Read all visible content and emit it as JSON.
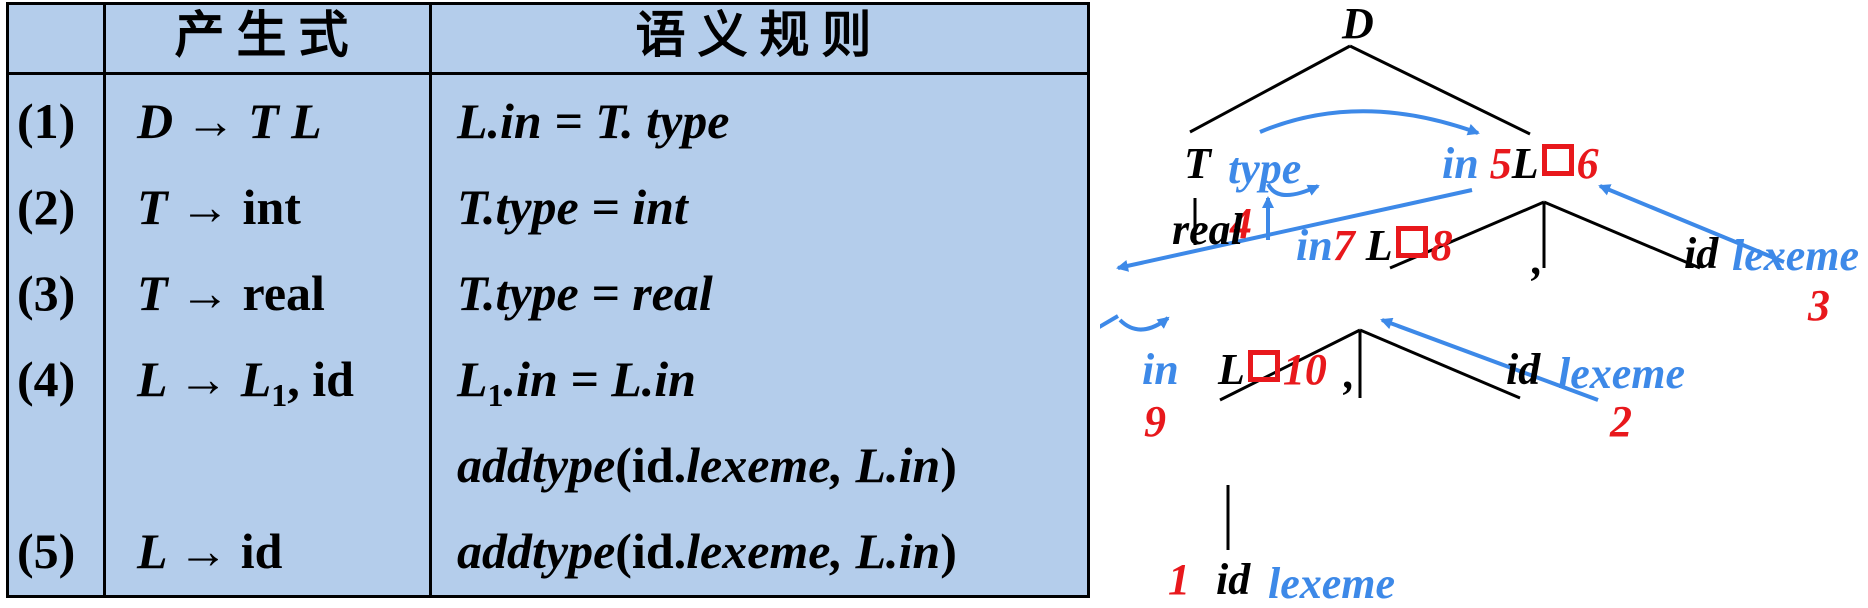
{
  "table": {
    "header": {
      "production": "产生式",
      "rule": "语义规则"
    },
    "rows": [
      {
        "num": "(1)",
        "prod_lhs": "D",
        "prod_rhs": "T L",
        "rule": "L.in = T. type"
      },
      {
        "num": "(2)",
        "prod_lhs": "T",
        "prod_rhs": "int",
        "rule": "T.type = int"
      },
      {
        "num": "(3)",
        "prod_lhs": "T",
        "prod_rhs": "real",
        "rule": "T.type = real"
      },
      {
        "num": "(4)",
        "prod_lhs": "L",
        "prod_rhs_sym": "L",
        "prod_rhs_sub": "1",
        "prod_rhs_tail": ", id",
        "rule_sym": "L",
        "rule_sub": "1",
        "rule_tail": ".in = L.in",
        "rule2_fn": "addtype",
        "rule2_open": "(id.",
        "rule2_arg": "lexeme, L.in",
        "rule2_close": ")"
      },
      {
        "num": "(5)",
        "prod_lhs": "L",
        "prod_rhs": "id",
        "rule_fn": "addtype",
        "rule_open": "(id.",
        "rule_arg": "lexeme, L.in",
        "rule_close": ")"
      }
    ],
    "arrow": "→"
  },
  "tree": {
    "root": "D",
    "T": "T",
    "type": "type",
    "in": "in",
    "L": "L",
    "id": "id",
    "lexeme": "lexeme",
    "real": "real",
    "comma": ",",
    "numbers": {
      "n1": "1",
      "n2": "2",
      "n3": "3",
      "n4": "4",
      "n5": "5",
      "n6": "6",
      "n7": "7",
      "n8": "8",
      "n9": "9",
      "n10": "10"
    },
    "colors": {
      "black": "#000000",
      "blue": "#3d89e8",
      "red": "#e8181c"
    }
  }
}
